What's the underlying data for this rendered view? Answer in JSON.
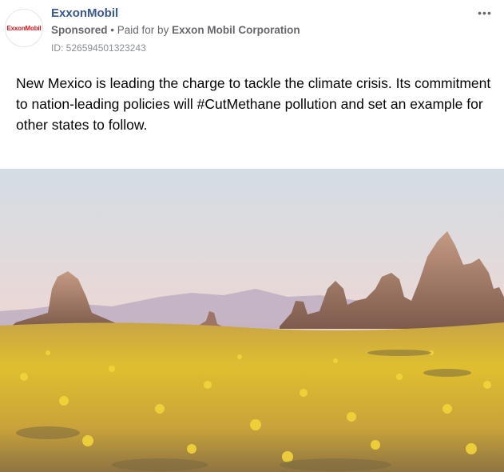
{
  "advertiser": {
    "name": "ExxonMobil",
    "logo_text": "ExxonMobil",
    "logo_color": "#e2161d"
  },
  "meta": {
    "sponsored": "Sponsored",
    "separator": "•",
    "paid_for_prefix": "Paid for by",
    "paid_for_by": "Exxon Mobil Corporation",
    "ad_id": "ID: 526594501323243"
  },
  "more_icon": "more-horizontal-icon",
  "body_text": "New Mexico is leading the charge to tackle the climate crisis. Its commitment to nation-leading policies will #CutMethane pollution and set an example for other states to follow.",
  "image": {
    "subject": "desert rock spires with yellow wildflowers at dusk",
    "sky_top": "#d6dfe6",
    "sky_bottom": "#f2c9c4",
    "field_color": "#e0bb2f"
  }
}
